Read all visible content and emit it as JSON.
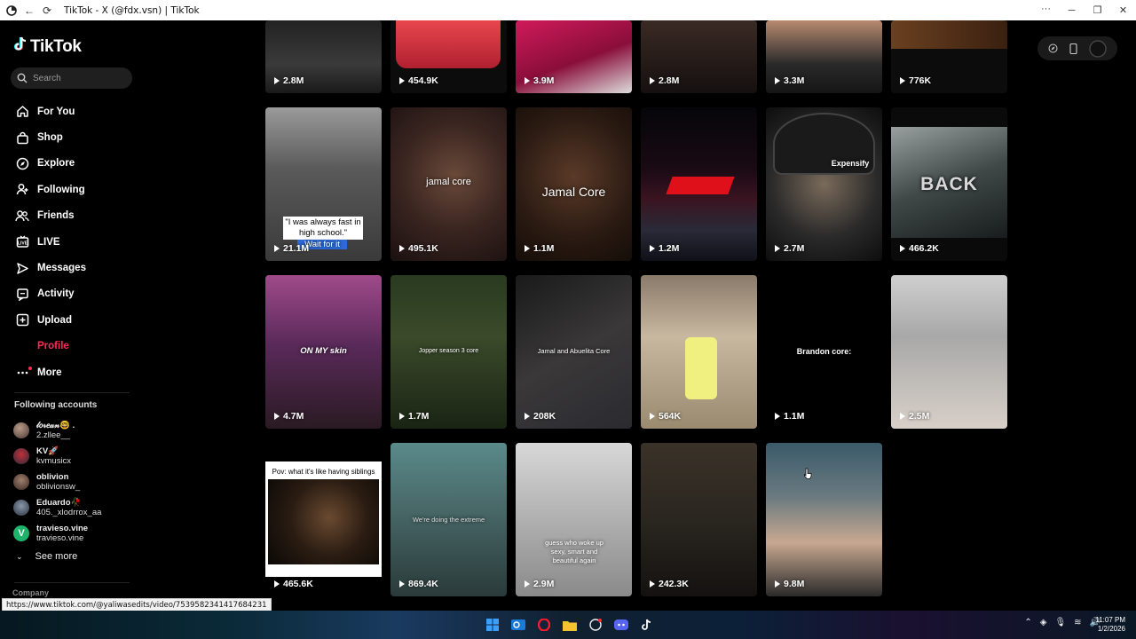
{
  "window": {
    "title": "TikTok - X (@fdx.vsn) | TikTok"
  },
  "brand": {
    "name": "TikTok",
    "accent": "#fe2c55"
  },
  "search": {
    "placeholder": "Search"
  },
  "nav": {
    "items": [
      {
        "label": "For You",
        "icon": "home-icon"
      },
      {
        "label": "Shop",
        "icon": "shop-bag-icon"
      },
      {
        "label": "Explore",
        "icon": "compass-icon"
      },
      {
        "label": "Following",
        "icon": "following-person-icon"
      },
      {
        "label": "Friends",
        "icon": "friends-icon"
      },
      {
        "label": "LIVE",
        "icon": "live-icon"
      },
      {
        "label": "Messages",
        "icon": "messages-icon"
      },
      {
        "label": "Activity",
        "icon": "activity-icon"
      },
      {
        "label": "Upload",
        "icon": "upload-icon"
      },
      {
        "label": "Profile",
        "icon": "profile-avatar"
      },
      {
        "label": "More",
        "icon": "more-dots-icon"
      }
    ]
  },
  "following_accounts": {
    "title": "Following accounts",
    "accounts": [
      {
        "display": "𝓁𝑜𝓇𝑒𝒶𝓃🤓 .",
        "handle": "2.zllee__",
        "color": "#6a5a50"
      },
      {
        "display": "KV🚀",
        "handle": "kvmusicx",
        "color": "#3a3a4a"
      },
      {
        "display": "oblivion",
        "handle": "oblivionsw_",
        "color": "#5a4636"
      },
      {
        "display": "Eduardo🥀",
        "handle": "405._xlodrrox_aa",
        "color": "#44505e"
      },
      {
        "display": "travieso.vine",
        "handle": "travieso.vine",
        "color": "#1db36a"
      }
    ],
    "see_more": "See more"
  },
  "footer": {
    "company": "Company"
  },
  "videos": [
    {
      "views": "2.8M"
    },
    {
      "views": "454.9K"
    },
    {
      "views": "3.9M"
    },
    {
      "views": "2.8M"
    },
    {
      "views": "3.3M"
    },
    {
      "views": "776K"
    },
    {
      "views": "21.1M",
      "caption": "\"I was always fast in high school.\"",
      "caption2": "Wait for it"
    },
    {
      "views": "495.1K",
      "caption": "jamal core"
    },
    {
      "views": "1.1M",
      "caption": "Jamal Core"
    },
    {
      "views": "1.2M"
    },
    {
      "views": "2.7M",
      "caption": "Expensify"
    },
    {
      "views": "466.2K",
      "caption": "BACK"
    },
    {
      "views": "4.7M",
      "caption": "ON MY skin"
    },
    {
      "views": "1.7M",
      "caption": "Jopper season 3 core"
    },
    {
      "views": "208K",
      "caption": "Jamal and Abuelita Core"
    },
    {
      "views": "564K"
    },
    {
      "views": "1.1M",
      "caption": "Brandon core:"
    },
    {
      "views": "2.5M"
    },
    {
      "views": "465.6K",
      "caption": "Pov: what it's like having siblings"
    },
    {
      "views": "869.4K",
      "caption": "We're doing the extreme"
    },
    {
      "views": "2.9M",
      "caption": "guess who woke up sexy, smart and beautiful again"
    },
    {
      "views": "242.3K"
    },
    {
      "views": "9.8M"
    }
  ],
  "status_bar": {
    "url": "https://www.tiktok.com/@yaliwasedits/video/7539582341417684231"
  },
  "clock": {
    "time": "11:07 PM",
    "date": "1/2/2026"
  }
}
